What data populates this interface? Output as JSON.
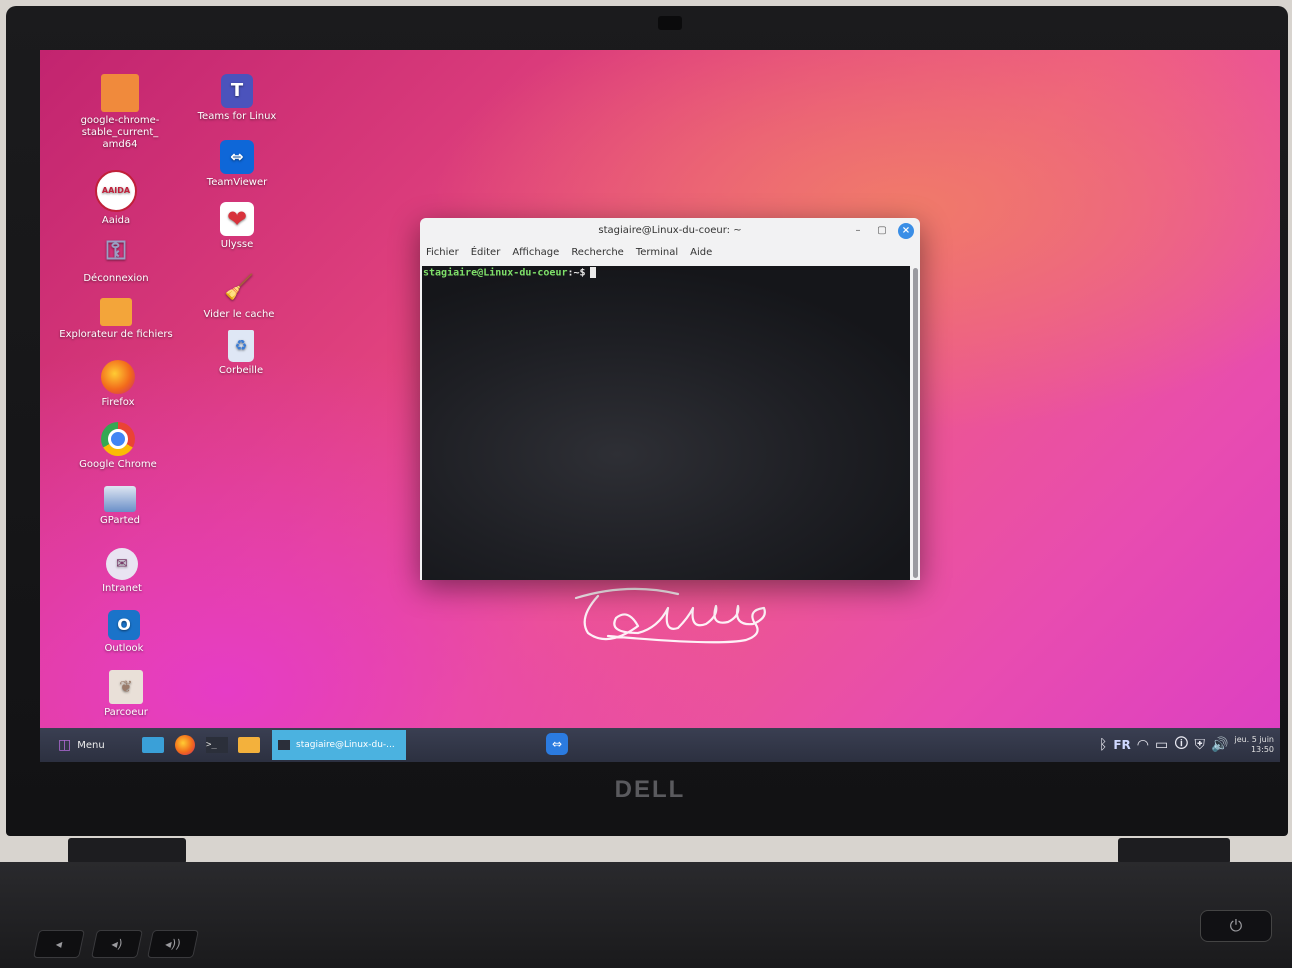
{
  "desktop": {
    "icons_col1": [
      {
        "label": "google-chrome-stable_current_amd64",
        "icon": "folder-icon",
        "color": "#f08a3c"
      },
      {
        "label": "Aaida",
        "icon": "aaida-icon",
        "color": "#ffffff"
      },
      {
        "label": "Déconnexion",
        "icon": "keys-icon",
        "color": "#8a8fb0"
      },
      {
        "label": "Explorateur de fichiers",
        "icon": "file-manager-icon",
        "color": "#f3a53a"
      },
      {
        "label": "Firefox",
        "icon": "firefox-icon",
        "color": "#f26a1b"
      },
      {
        "label": "Google Chrome",
        "icon": "chrome-icon",
        "color": "#34a853"
      },
      {
        "label": "GParted",
        "icon": "gparted-icon",
        "color": "#6a8fc8"
      },
      {
        "label": "Intranet",
        "icon": "intranet-icon",
        "color": "#e9e4f2"
      },
      {
        "label": "Outlook",
        "icon": "outlook-icon",
        "color": "#1a73c9"
      },
      {
        "label": "Parcoeur",
        "icon": "parcoeur-icon",
        "color": "#e9e0d8"
      }
    ],
    "icons_col2": [
      {
        "label": "Teams for Linux",
        "icon": "teams-icon",
        "color": "#4b53bc"
      },
      {
        "label": "TeamViewer",
        "icon": "teamviewer-icon",
        "color": "#0e67d8"
      },
      {
        "label": "Ulysse",
        "icon": "ulysse-icon",
        "color": "#d8323c"
      },
      {
        "label": "Vider le cache",
        "icon": "broom-icon",
        "color": "#f2b13c"
      },
      {
        "label": "Corbeille",
        "icon": "trash-icon",
        "color": "#dfe7f5"
      }
    ]
  },
  "terminal": {
    "title": "stagiaire@Linux-du-coeur: ~",
    "menu": [
      "Fichier",
      "Éditer",
      "Affichage",
      "Recherche",
      "Terminal",
      "Aide"
    ],
    "prompt_user": "stagiaire@Linux-du-coeur",
    "prompt_suffix": ":~$"
  },
  "taskbar": {
    "menu_label": "Menu",
    "window_label": "stagiaire@Linux-du-...",
    "keyboard_layout": "FR",
    "clock_date": "jeu. 5 juin",
    "clock_time": "13:50"
  },
  "brand": "DELL"
}
